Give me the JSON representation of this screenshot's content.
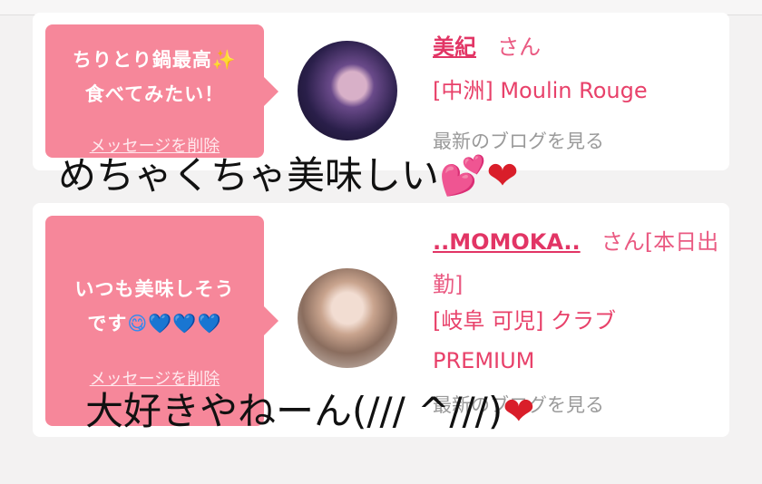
{
  "entries": [
    {
      "message_line1": "ちりとり鍋最高",
      "message_sparkle": "✨",
      "message_line2": "食べてみたい！",
      "delete_label": "メッセージを削除",
      "name": "美紀",
      "san": "さん",
      "shop": "[中洲] Moulin Rouge",
      "blog_label": "最新のブログを見る"
    },
    {
      "message_line1": "いつも美味しそう",
      "message_line2": "です",
      "message_emoji": "😋💙💙💙",
      "delete_label": "メッセージを削除",
      "name": "..MOMOKA..",
      "san": "さん[本日出勤]",
      "shop": "[岐阜 可児] クラブPREMIUM",
      "blog_label": "最新のブログを見る"
    }
  ],
  "overlay": {
    "text1": "めちゃくちゃ美味しい",
    "text1_hearts_pink": "💕",
    "text1_heart_red": "❤",
    "text2": "大好きやねーん(/// ^///)",
    "text2_heart_red": "❤"
  },
  "colors": {
    "bubble": "#f6879a",
    "link_pink": "#e23565",
    "background": "#f3f2f2"
  }
}
